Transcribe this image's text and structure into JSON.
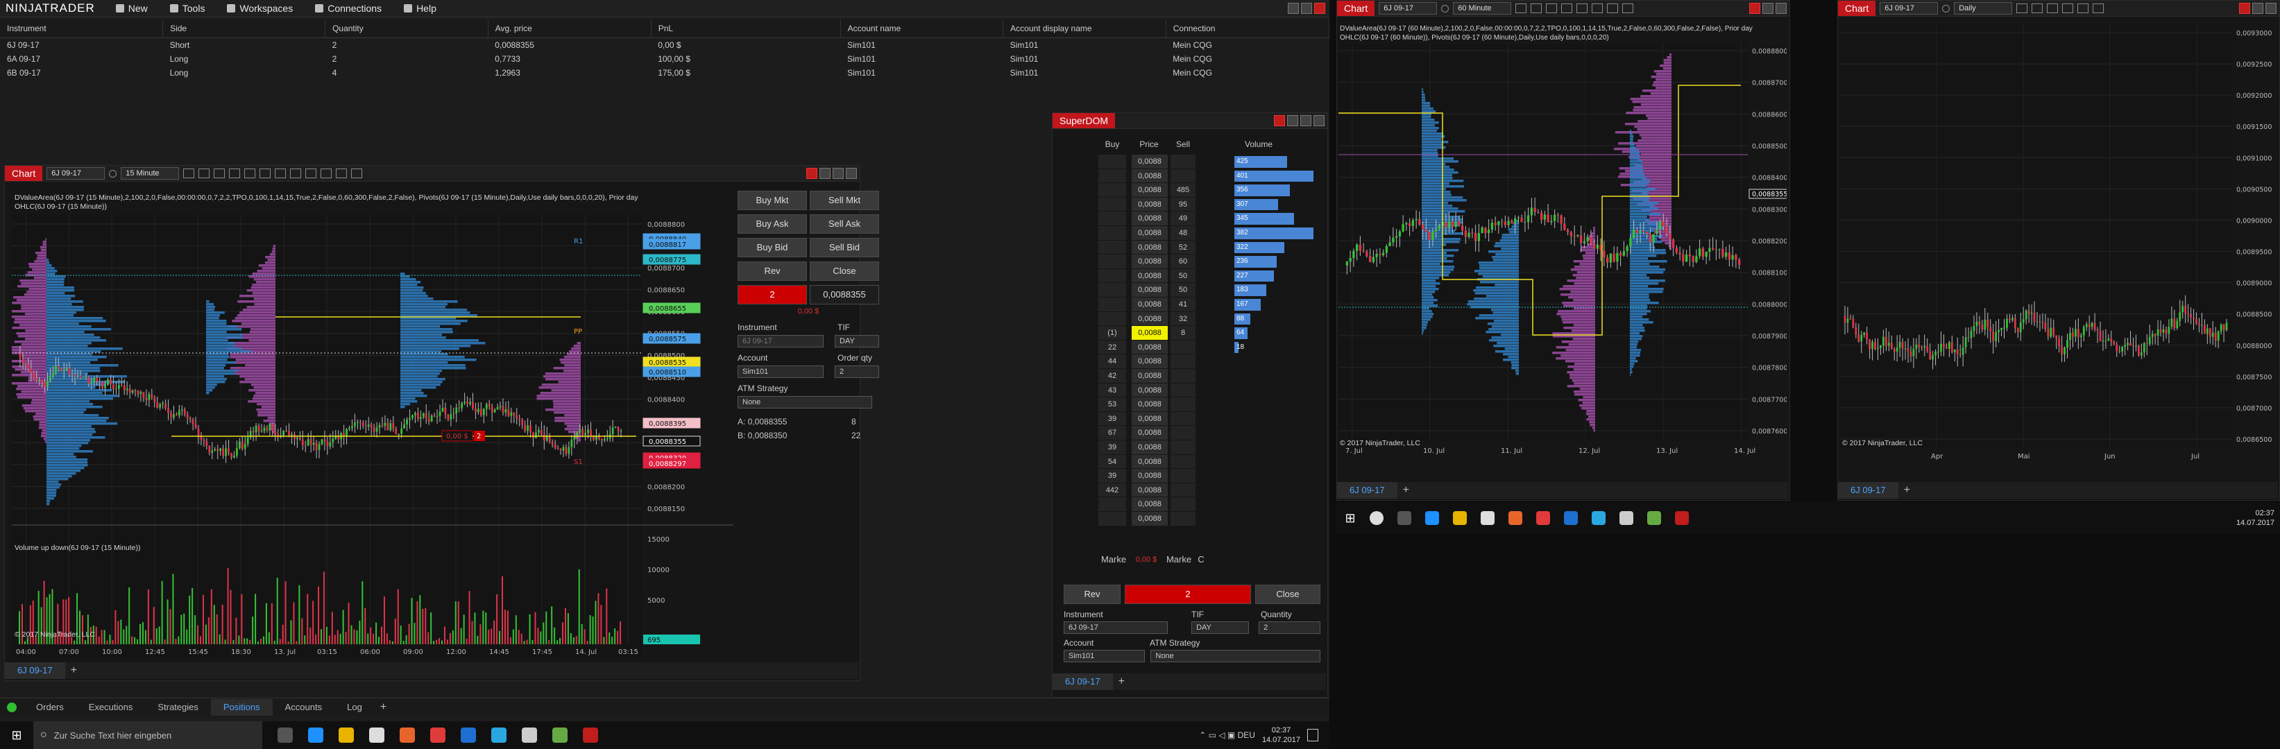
{
  "app": {
    "logo": "NINJATRADER"
  },
  "menu": [
    {
      "label": "New",
      "icon": "plus-icon"
    },
    {
      "label": "Tools",
      "icon": "tools-icon"
    },
    {
      "label": "Workspaces",
      "icon": "workspaces-icon"
    },
    {
      "label": "Connections",
      "icon": "connections-icon"
    },
    {
      "label": "Help",
      "icon": "help-icon"
    }
  ],
  "positions": {
    "columns": [
      "Instrument",
      "Side",
      "Quantity",
      "Avg. price",
      "PnL",
      "Account name",
      "Account display name",
      "Connection"
    ],
    "rows": [
      [
        "6J 09-17",
        "Short",
        "2",
        "0,0088355",
        "0,00 $",
        "Sim101",
        "Sim101",
        "Mein CQG"
      ],
      [
        "6A 09-17",
        "Long",
        "2",
        "0,7733",
        "100,00 $",
        "Sim101",
        "Sim101",
        "Mein CQG"
      ],
      [
        "6B 09-17",
        "Long",
        "4",
        "1,2963",
        "175,00 $",
        "Sim101",
        "Sim101",
        "Mein CQG"
      ]
    ]
  },
  "bottom_tabs": [
    "Orders",
    "Executions",
    "Strategies",
    "Positions",
    "Accounts",
    "Log"
  ],
  "chart1": {
    "tag": "Chart",
    "instrument": "6J 09-17",
    "interval": "15 Minute",
    "info1": "DValueArea(6J 09-17 (15 Minute),2,100,2,0,False,00:00:00,0,7,2,2,TPO,0,100,1,14,15,True,2,False,0,60,300,False,2,False), Pivots(6J 09-17 (15 Minute),Daily,Use daily bars,0,0,0,20), Prior day",
    "info2": "OHLC(6J 09-17 (15 Minute))",
    "volume_label": "Volume up down(6J 09-17 (15 Minute))",
    "copyright": "© 2017 NinjaTrader, LLC",
    "x_ticks": [
      "04:00",
      "07:00",
      "10:00",
      "12:45",
      "15:45",
      "18:30",
      "13. Jul",
      "03:15",
      "06:00",
      "09:00",
      "12:00",
      "14:45",
      "17:45",
      "14. Jul",
      "03:15"
    ],
    "y_ticks": [
      "0,0088800",
      "0,0088750",
      "0,0088700",
      "0,0088650",
      "0,0088600",
      "0,0088550",
      "0,0088500",
      "0,0088450",
      "0,0088400",
      "0,0088350",
      "0,0088300",
      "0,0088250",
      "0,0088200",
      "0,0088150"
    ],
    "price_labels": [
      {
        "text": "0,0088840",
        "color": "#4aa0e8"
      },
      {
        "text": "0,0088817",
        "color": "#4aa0e8"
      },
      {
        "text": "0,0088775",
        "color": "#2cb8c8"
      },
      {
        "text": "0,0088655",
        "color": "#58d058"
      },
      {
        "text": "0,0088575",
        "color": "#4aa0e8"
      },
      {
        "text": "0,0088535",
        "color": "#f0e020"
      },
      {
        "text": "0,0088510",
        "color": "#4aa0e8"
      },
      {
        "text": "0,0088395",
        "color": "#f4c0c8"
      },
      {
        "text": "0,0088355",
        "color": "#111111"
      },
      {
        "text": "0,0088320",
        "color": "#e02040"
      },
      {
        "text": "0,0088297",
        "color": "#e02040"
      }
    ],
    "vol_ticks": [
      "15000",
      "10000",
      "5000"
    ],
    "vol_badge": "695",
    "order_marker": "0,00 $",
    "order_qty": "2",
    "pivot_labels": [
      "R1",
      "PP",
      "S1"
    ],
    "tab": "6J 09-17",
    "chart_trader": {
      "buttons": [
        [
          "Buy Mkt",
          "Sell Mkt"
        ],
        [
          "Buy Ask",
          "Sell Ask"
        ],
        [
          "Buy Bid",
          "Sell Bid"
        ],
        [
          "Rev",
          "Close"
        ]
      ],
      "position_qty": "2",
      "position_price": "0,0088355",
      "pnl": "0,00 $",
      "instrument_label": "Instrument",
      "instrument_value": "6J 09-17",
      "tif_label": "TIF",
      "tif_value": "DAY",
      "account_label": "Account",
      "account_value": "Sim101",
      "qty_label": "Order qty",
      "qty_value": "2",
      "atm_label": "ATM Strategy",
      "atm_value": "None",
      "ask_line": "A:  0,0088355",
      "ask_size": "8",
      "bid_line": "B:  0,0088350",
      "bid_size": "22"
    }
  },
  "superdom": {
    "title": "SuperDOM",
    "headers": [
      "Buy",
      "Price",
      "Sell",
      "Volume"
    ],
    "rows": [
      {
        "buy": "",
        "price": "0,0088",
        "sell": "",
        "vol": "425",
        "vw": 0.4
      },
      {
        "buy": "",
        "price": "0,0088",
        "sell": "",
        "vol": "401",
        "vw": 0.6
      },
      {
        "buy": "",
        "price": "0,0088",
        "sell": "485",
        "vol": "356",
        "vw": 0.42
      },
      {
        "buy": "",
        "price": "0,0088",
        "sell": "95",
        "vol": "307",
        "vw": 0.33
      },
      {
        "buy": "",
        "price": "0,0088",
        "sell": "49",
        "vol": "345",
        "vw": 0.45
      },
      {
        "buy": "",
        "price": "0,0088",
        "sell": "48",
        "vol": "382",
        "vw": 0.6
      },
      {
        "buy": "",
        "price": "0,0088",
        "sell": "52",
        "vol": "322",
        "vw": 0.38
      },
      {
        "buy": "",
        "price": "0,0088",
        "sell": "60",
        "vol": "236",
        "vw": 0.32
      },
      {
        "buy": "",
        "price": "0,0088",
        "sell": "50",
        "vol": "227",
        "vw": 0.3
      },
      {
        "buy": "",
        "price": "0,0088",
        "sell": "50",
        "vol": "183",
        "vw": 0.24
      },
      {
        "buy": "",
        "price": "0,0088",
        "sell": "41",
        "vol": "167",
        "vw": 0.2
      },
      {
        "buy": "",
        "price": "0,0088",
        "sell": "32",
        "vol": "88",
        "vw": 0.12
      },
      {
        "buy": "(1)",
        "price": "0,0088",
        "sell": "8",
        "vol": "64",
        "vw": 0.1
      },
      {
        "buy": "22",
        "price": "0,0088",
        "sell": "",
        "vol": "18",
        "vw": 0.0
      },
      {
        "buy": "44",
        "price": "0,0088",
        "sell": "",
        "vol": "",
        "vw": 0
      },
      {
        "buy": "42",
        "price": "0,0088",
        "sell": "",
        "vol": "",
        "vw": 0
      },
      {
        "buy": "43",
        "price": "0,0088",
        "sell": "",
        "vol": "",
        "vw": 0
      },
      {
        "buy": "53",
        "price": "0,0088",
        "sell": "",
        "vol": "",
        "vw": 0
      },
      {
        "buy": "39",
        "price": "0,0088",
        "sell": "",
        "vol": "",
        "vw": 0
      },
      {
        "buy": "67",
        "price": "0,0088",
        "sell": "",
        "vol": "",
        "vw": 0
      },
      {
        "buy": "39",
        "price": "0,0088",
        "sell": "",
        "vol": "",
        "vw": 0
      },
      {
        "buy": "54",
        "price": "0,0088",
        "sell": "",
        "vol": "",
        "vw": 0
      },
      {
        "buy": "39",
        "price": "0,0088",
        "sell": "",
        "vol": "",
        "vw": 0
      },
      {
        "buy": "442",
        "price": "0,0088",
        "sell": "",
        "vol": "",
        "vw": 0
      },
      {
        "buy": "",
        "price": "0,0088",
        "sell": "",
        "vol": "",
        "vw": 0
      },
      {
        "buy": "",
        "price": "0,0088",
        "sell": "",
        "vol": "",
        "vw": 0
      }
    ],
    "footer_left": "Marke",
    "footer_pnl": "0,00 $",
    "footer_right": "Marke",
    "footer_c": "C",
    "rev": "Rev",
    "qty": "2",
    "close": "Close",
    "instrument_label": "Instrument",
    "instrument_value": "6J 09-17",
    "tif_label": "TIF",
    "tif_value": "DAY",
    "quantity_label": "Quantity",
    "quantity_value": "2",
    "account_label": "Account",
    "account_value": "Sim101",
    "atm_label": "ATM Strategy",
    "atm_value": "None",
    "tab": "6J 09-17"
  },
  "chart2": {
    "tag": "Chart",
    "instrument": "6J 09-17",
    "interval": "60 Minute",
    "info1": "DValueArea(6J 09-17 (60 Minute),2,100,2,0,False,00:00:00,0,7,2,2,TPO,0,100,1,14,15,True,2,False,0,60,300,False,2,False), Prior day",
    "info2": "OHLC(6J 09-17 (60 Minute)), Pivots(6J 09-17 (60 Minute),Daily,Use daily bars,0,0,0,20)",
    "copyright": "© 2017 NinjaTrader, LLC",
    "x_ticks": [
      "7. Jul",
      "10. Jul",
      "11. Jul",
      "12. Jul",
      "13. Jul",
      "14. Jul"
    ],
    "y_ticks": [
      "0,0088800",
      "0,0088700",
      "0,0088600",
      "0,0088500",
      "0,0088400",
      "0,0088300",
      "0,0088200",
      "0,0088100",
      "0,0088000",
      "0,0087900",
      "0,0087800",
      "0,0087700",
      "0,0087600"
    ],
    "last_price": "0,0088355",
    "tab": "6J 09-17"
  },
  "chart3": {
    "tag": "Chart",
    "instrument": "6J 09-17",
    "interval": "Daily",
    "copyright": "© 2017 NinjaTrader, LLC",
    "x_ticks": [
      "Apr",
      "Mai",
      "Jun",
      "Jul"
    ],
    "y_ticks": [
      "0,0093000",
      "0,0092500",
      "0,0092000",
      "0,0091500",
      "0,0091000",
      "0,0090500",
      "0,0090000",
      "0,0089500",
      "0,0089000",
      "0,0088500",
      "0,0088000",
      "0,0087500",
      "0,0087000",
      "0,0086500"
    ],
    "tab": "6J 09-17"
  },
  "taskbar": {
    "search_placeholder": "Zur Suche Text hier eingeben",
    "time": "02:37",
    "date": "14.07.2017",
    "time2": "02:37",
    "date2": "14.07.2017"
  }
}
